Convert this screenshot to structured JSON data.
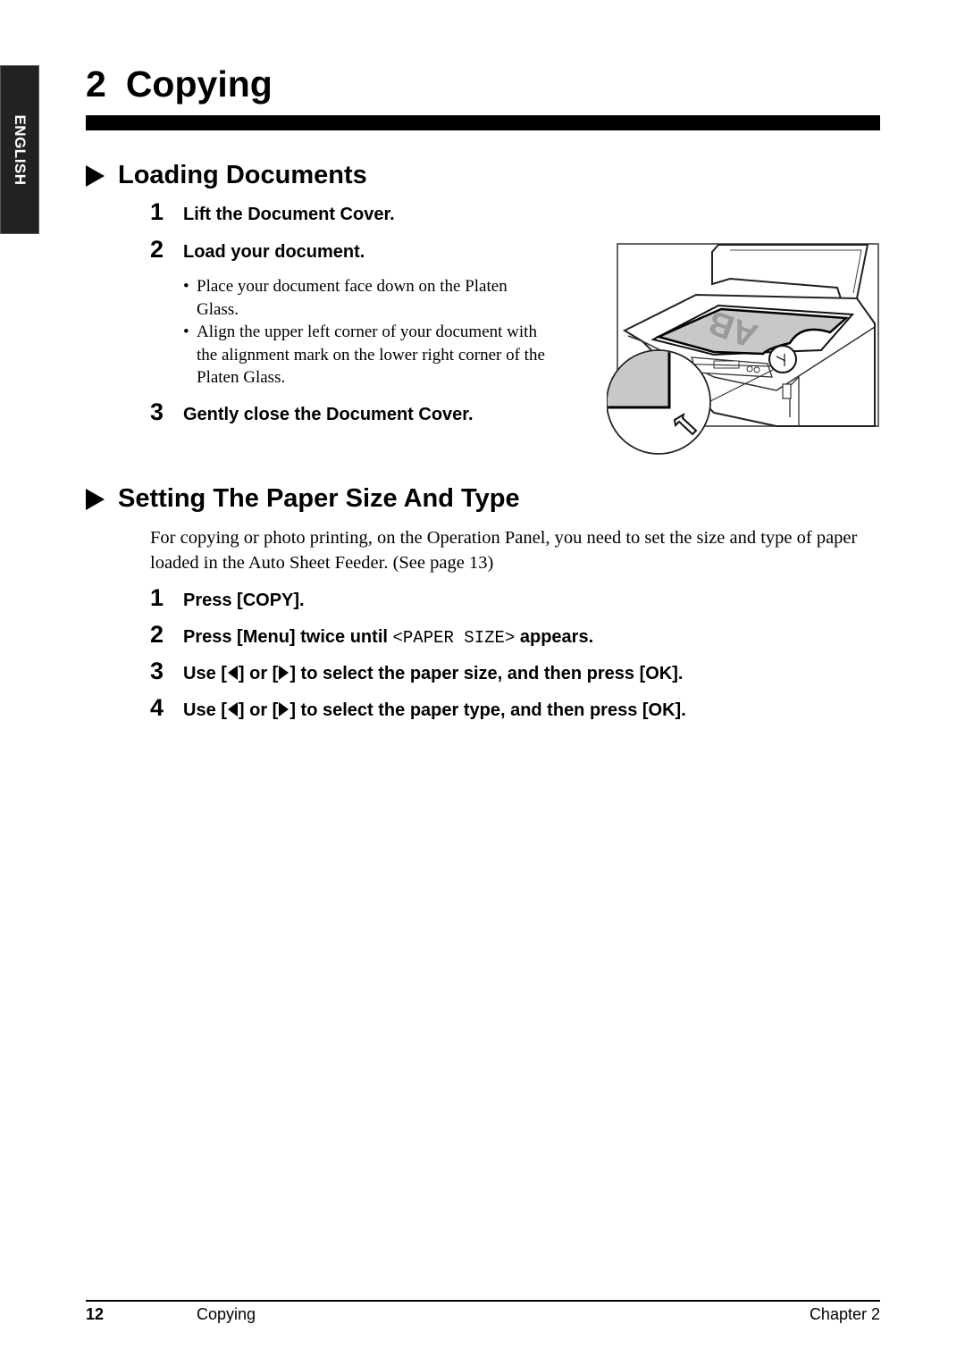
{
  "side_tab": {
    "label": "ENGLISH"
  },
  "chapter": {
    "number": "2",
    "title": "Copying"
  },
  "sections": [
    {
      "title": "Loading Documents",
      "steps": [
        {
          "number": "1",
          "text": "Lift the Document Cover."
        },
        {
          "number": "2",
          "text": "Load your document."
        },
        {
          "number": "3",
          "text": "Gently close the Document Cover."
        }
      ],
      "bullets": [
        "Place your document face down on the Platen Glass.",
        "Align the upper left corner of your document with the alignment mark on the lower right corner of the Platen Glass."
      ],
      "illustration": {
        "icon": "scanner-platen-illustration",
        "doc_letters": "AB"
      }
    },
    {
      "title": "Setting The Paper Size And Type",
      "intro": "For copying or photo printing, on the Operation Panel, you need to set the size and type of paper loaded in the Auto Sheet Feeder. (See page 13)",
      "steps": [
        {
          "number": "1",
          "text": "Press [COPY]."
        },
        {
          "number": "2",
          "text_before": "Press [Menu] twice until ",
          "code": "<PAPER SIZE>",
          "text_after": " appears."
        },
        {
          "number": "3",
          "text_a": "Use [",
          "text_b": "] or [",
          "text_c": "] to select the paper size, and then press [OK]."
        },
        {
          "number": "4",
          "text_a": "Use [",
          "text_b": "] or [",
          "text_c": "] to select the paper type, and then press [OK]."
        }
      ]
    }
  ],
  "footer": {
    "page_number": "12",
    "section": "Copying",
    "chapter": "Chapter 2"
  }
}
